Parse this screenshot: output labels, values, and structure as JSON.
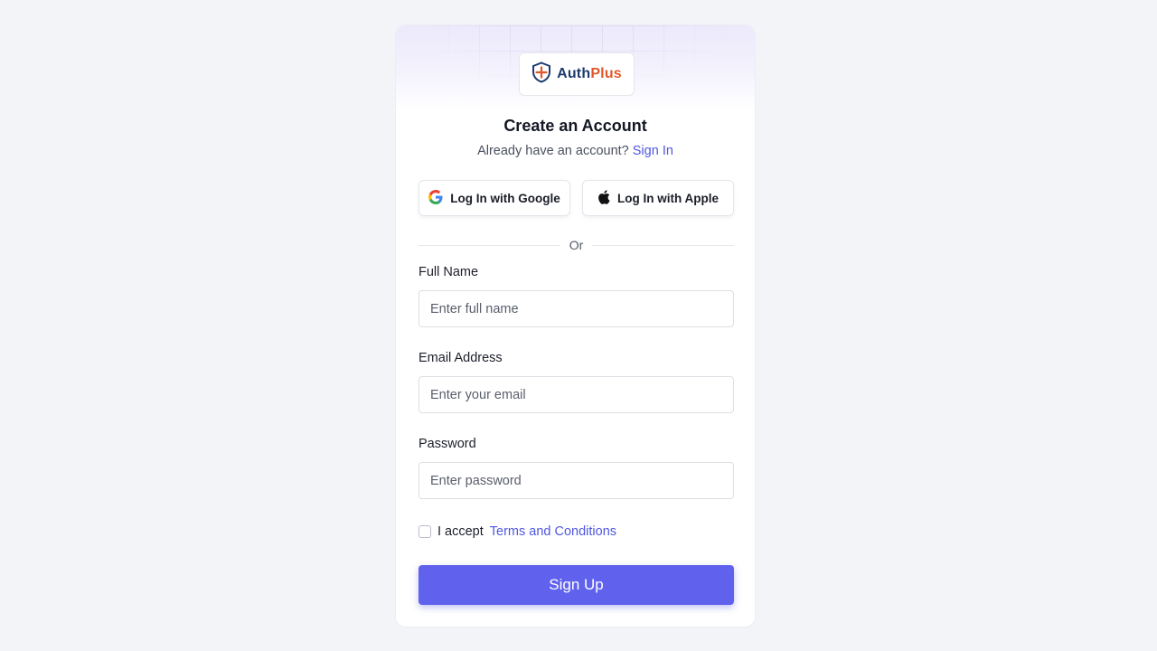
{
  "brand": {
    "name_part1": "Auth",
    "name_part2": "Plus"
  },
  "header": {
    "title": "Create an Account",
    "subtitle_text": "Already have an account?",
    "signin_link": "Sign In"
  },
  "social": {
    "google_label": "Log In with Google",
    "apple_label": "Log In with Apple"
  },
  "divider_text": "Or",
  "form": {
    "full_name": {
      "label": "Full Name",
      "placeholder": "Enter full name",
      "value": ""
    },
    "email": {
      "label": "Email Address",
      "placeholder": "Enter your email",
      "value": ""
    },
    "password": {
      "label": "Password",
      "placeholder": "Enter password",
      "value": ""
    },
    "terms_prefix": "I accept",
    "terms_link": "Terms and Conditions",
    "terms_checked": false,
    "submit_label": "Sign Up"
  },
  "colors": {
    "accent": "#6062ee",
    "link": "#5057e0",
    "brand_dark": "#1e3a6e",
    "brand_orange": "#e0582a"
  },
  "icons": {
    "logo": "shield-plus-icon",
    "google": "google-icon",
    "apple": "apple-icon"
  }
}
